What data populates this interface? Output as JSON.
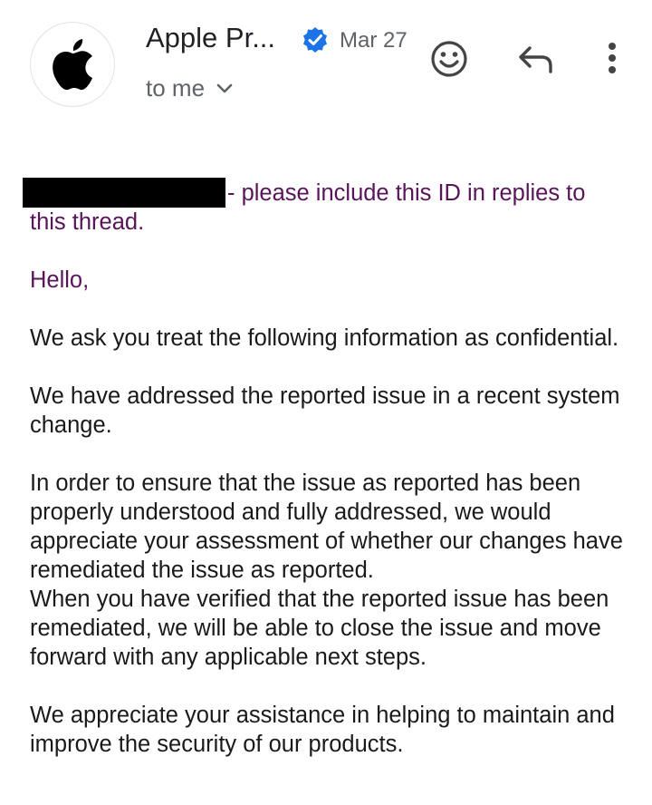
{
  "header": {
    "sender_name": "Apple Pr...",
    "date": "Mar 27",
    "recipient_label": "to me",
    "icons": [
      "apple-logo-icon",
      "verified-badge-icon",
      "chevron-down-icon",
      "emoji-reaction-icon",
      "reply-icon",
      "more-vert-icon"
    ]
  },
  "message": {
    "id_note": "- please include this ID in replies to this thread.",
    "greeting": "Hello,",
    "paragraph_1": "We ask you treat the following information as confidential.",
    "paragraph_2": "We have addressed the reported issue in a recent system change.",
    "paragraph_3a": "In order to ensure that the issue as reported has been properly understood and fully addressed, we would appreciate your assessment of whether our changes have remediated the issue as reported.",
    "paragraph_3b": "When you have verified that the reported issue has been remediated, we will be able to close the issue and move forward with any applicable next steps.",
    "paragraph_4": "We appreciate your assistance in helping to maintain and improve the security of our products."
  },
  "colors": {
    "quoted_text": "#5a1459",
    "verified_badge": "#1a73e8",
    "secondary_text": "#5f6368"
  }
}
